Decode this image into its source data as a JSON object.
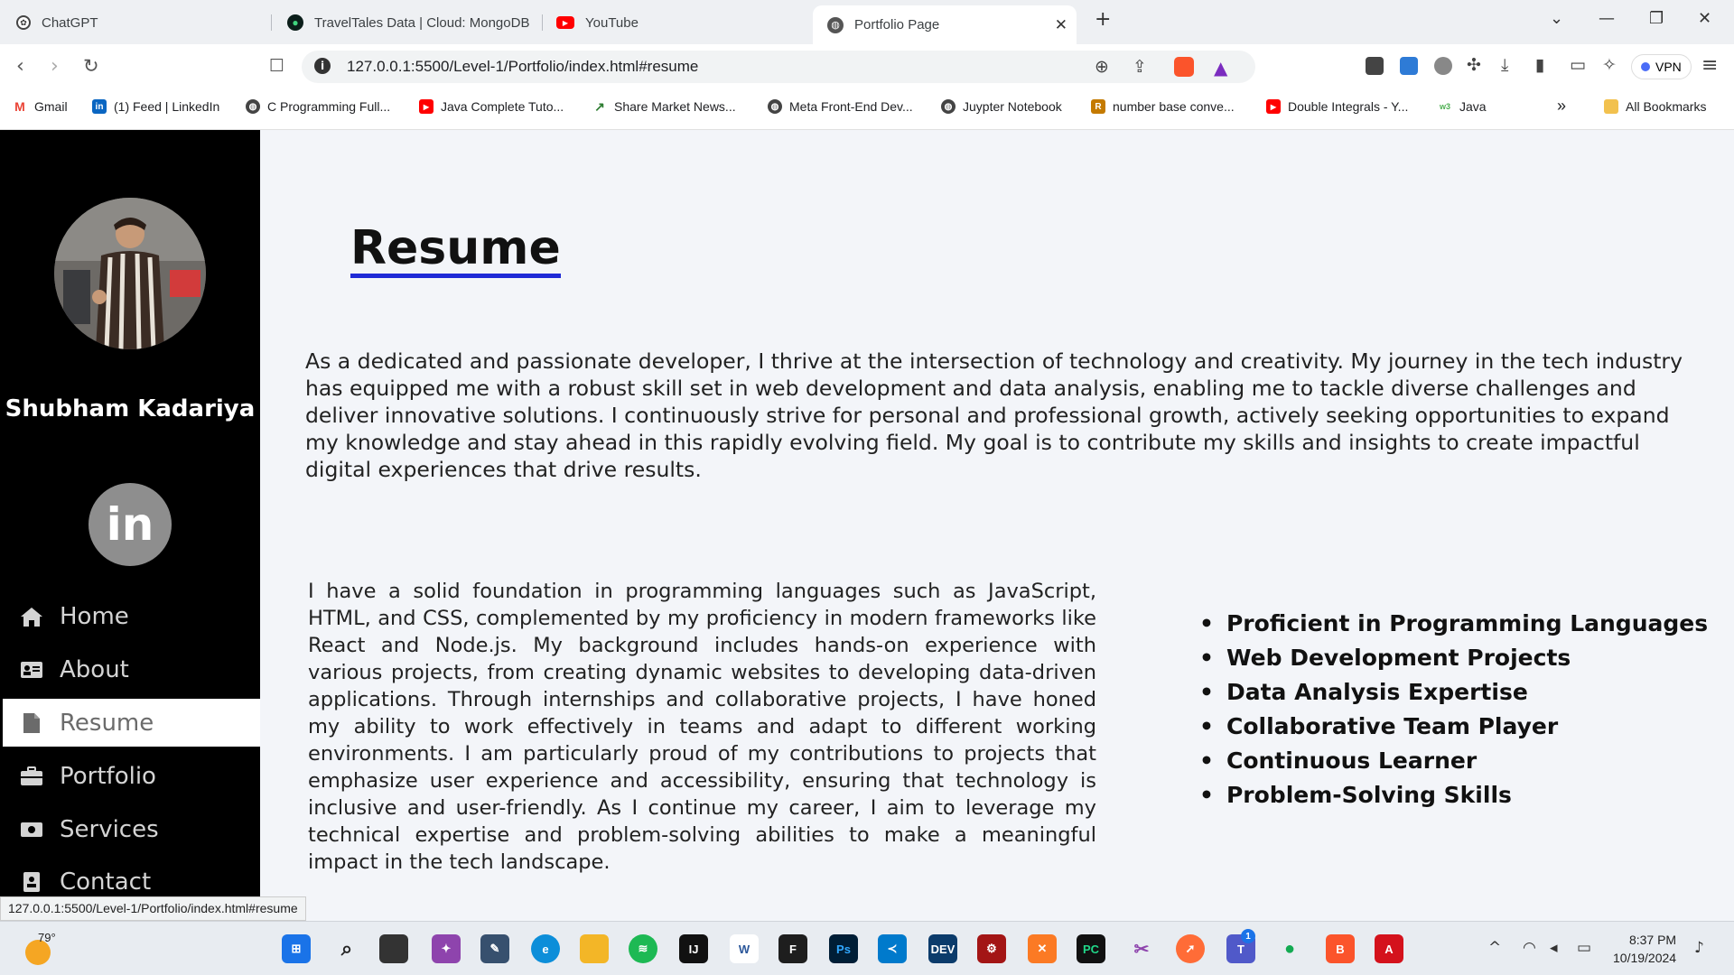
{
  "browser": {
    "tabs": [
      {
        "label": "ChatGPT",
        "icon": "chatgpt-icon"
      },
      {
        "label": "TravelTales Data | Cloud: MongoDB",
        "icon": "mongodb-icon"
      },
      {
        "label": "YouTube",
        "icon": "youtube-icon"
      },
      {
        "label": "Portfolio Page",
        "icon": "globe-icon",
        "active": true
      }
    ],
    "new_tab": "+",
    "url": "127.0.0.1:5500/Level-1/Portfolio/index.html#resume",
    "vpn_label": "VPN",
    "bookmarks": [
      {
        "label": "Gmail",
        "icon": "gmail-icon",
        "color": "#ea4335"
      },
      {
        "label": "(1) Feed | LinkedIn",
        "icon": "linkedin-icon",
        "color": "#0a66c2"
      },
      {
        "label": "C Programming Full...",
        "icon": "globe-icon",
        "color": "#333333"
      },
      {
        "label": "Java Complete Tuto...",
        "icon": "youtube-icon",
        "color": "#ff0000"
      },
      {
        "label": "Share Market News...",
        "icon": "chart-icon",
        "color": "#2e7d32"
      },
      {
        "label": "Meta Front-End Dev...",
        "icon": "globe-icon",
        "color": "#333333"
      },
      {
        "label": "Juypter Notebook",
        "icon": "globe-icon",
        "color": "#333333"
      },
      {
        "label": "number base conve...",
        "icon": "rapidtables-icon",
        "color": "#c47a00"
      },
      {
        "label": "Double Integrals - Y...",
        "icon": "youtube-icon",
        "color": "#ff0000"
      },
      {
        "label": "Java",
        "icon": "w3schools-icon",
        "color": "#4caf50"
      }
    ],
    "more_bookmarks": "»",
    "all_bookmarks": "All Bookmarks",
    "status_url": "127.0.0.1:5500/Level-1/Portfolio/index.html#resume"
  },
  "sidebar": {
    "name": "Shubham Kadariya",
    "linkedin_label": "in",
    "nav": [
      {
        "label": "Home",
        "icon": "home-icon"
      },
      {
        "label": "About",
        "icon": "id-card-icon"
      },
      {
        "label": "Resume",
        "icon": "file-icon",
        "active": true
      },
      {
        "label": "Portfolio",
        "icon": "briefcase-icon"
      },
      {
        "label": "Services",
        "icon": "money-icon"
      },
      {
        "label": "Contact",
        "icon": "contact-book-icon"
      }
    ]
  },
  "main": {
    "title": "Resume",
    "intro": "As a dedicated and passionate developer, I thrive at the intersection of technology and creativity. My journey in the tech industry has equipped me with a robust skill set in web development and data analysis, enabling me to tackle diverse challenges and deliver innovative solutions. I continuously strive for personal and professional growth, actively seeking opportunities to expand my knowledge and stay ahead in this rapidly evolving field. My goal is to contribute my skills and insights to create impactful digital experiences that drive results.",
    "detail": "I have a solid foundation in programming languages such as JavaScript, HTML, and CSS, complemented by my proficiency in modern frameworks like React and Node.js. My background includes hands-on experience with various projects, from creating dynamic websites to developing data-driven applications. Through internships and collaborative projects, I have honed my ability to work effectively in teams and adapt to different working environments. I am particularly proud of my contributions to projects that emphasize user experience and accessibility, ensuring that technology is inclusive and user-friendly. As I continue my career, I aim to leverage my technical expertise and problem-solving abilities to make a meaningful impact in the tech landscape.",
    "skills": [
      "Proficient in Programming Languages",
      "Web Development Projects",
      "Data Analysis Expertise",
      "Collaborative Team Player",
      "Continuous Learner",
      "Problem-Solving Skills"
    ]
  },
  "taskbar": {
    "weather": "79°",
    "time": "8:37 PM",
    "date": "10/19/2024",
    "teams_badge": "1"
  },
  "colors": {
    "sidebar_bg": "#000000",
    "page_bg": "#f3f5f9",
    "title_underline": "#1f2ad6",
    "active_nav_bg": "#ffffff"
  }
}
